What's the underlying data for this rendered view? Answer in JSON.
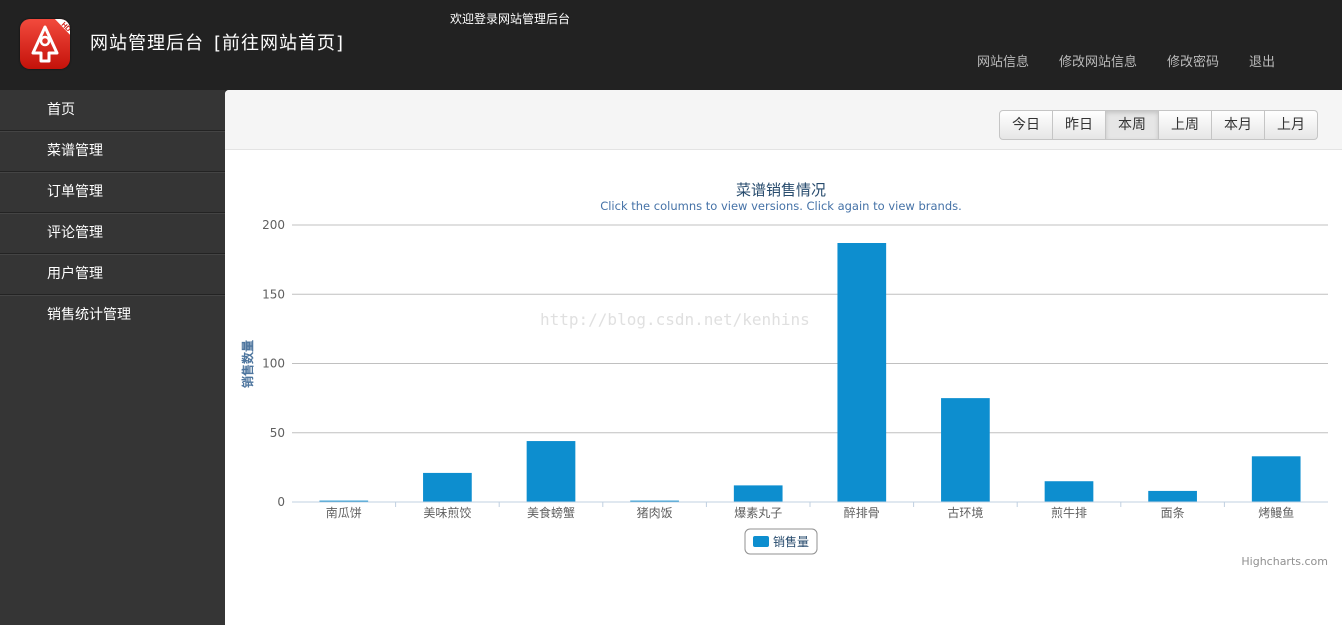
{
  "header": {
    "site_name": "网站管理后台",
    "home_link": "[前往网站首页]",
    "welcome": "欢迎登录网站管理后台",
    "nav": [
      "网站信息",
      "修改网站信息",
      "修改密码",
      "退出"
    ],
    "logo_badge": "HD"
  },
  "sidebar": {
    "items": [
      "首页",
      "菜谱管理",
      "订单管理",
      "评论管理",
      "用户管理",
      "销售统计管理"
    ]
  },
  "toolbar": {
    "buttons": [
      "今日",
      "昨日",
      "本周",
      "上周",
      "本月",
      "上月"
    ],
    "active": "本周"
  },
  "watermark": "http://blog.csdn.net/kenhins",
  "chart_data": {
    "type": "bar",
    "title": "菜谱销售情况",
    "subtitle": "Click the columns to view versions. Click again to view brands.",
    "ylabel": "销售数量",
    "xlabel": "",
    "ylim": [
      0,
      200
    ],
    "yticks": [
      0,
      50,
      100,
      150,
      200
    ],
    "grid": true,
    "legend": "bottom-center",
    "credits": "Highcharts.com",
    "categories": [
      "南瓜饼",
      "美味煎饺",
      "美食螃蟹",
      "猪肉饭",
      "爆素丸子",
      "醉排骨",
      "古环境",
      "煎牛排",
      "面条",
      "烤鳗鱼"
    ],
    "series": [
      {
        "name": "销售量",
        "color": "#0d8ecf",
        "values": [
          1,
          21,
          44,
          1,
          12,
          187,
          75,
          15,
          8,
          33
        ]
      }
    ]
  },
  "colors": {
    "header_bg": "#222222",
    "sidebar_bg": "#353535",
    "bar": "#0d8ecf",
    "title": "#274b6d",
    "subtitle": "#4572a7"
  }
}
